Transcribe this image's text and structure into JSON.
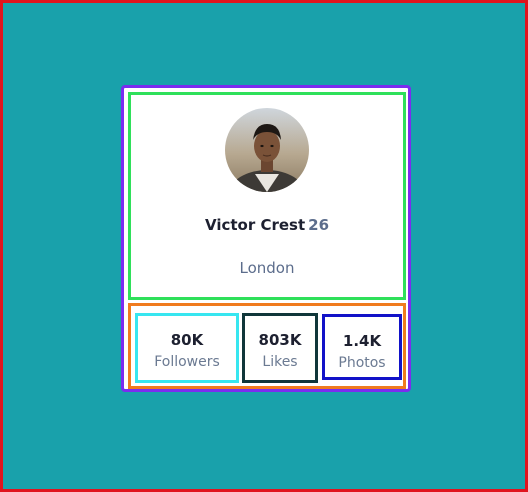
{
  "profile": {
    "name": "Victor Crest",
    "age": "26",
    "location": "London"
  },
  "stats": [
    {
      "value": "80K",
      "label": "Followers"
    },
    {
      "value": "803K",
      "label": "Likes"
    },
    {
      "value": "1.4K",
      "label": "Photos"
    }
  ],
  "colors": {
    "page_background": "#19a1ab",
    "card_background": "#ffffff",
    "primary_text": "#1d2030",
    "secondary_text": "#5c6d8c"
  }
}
